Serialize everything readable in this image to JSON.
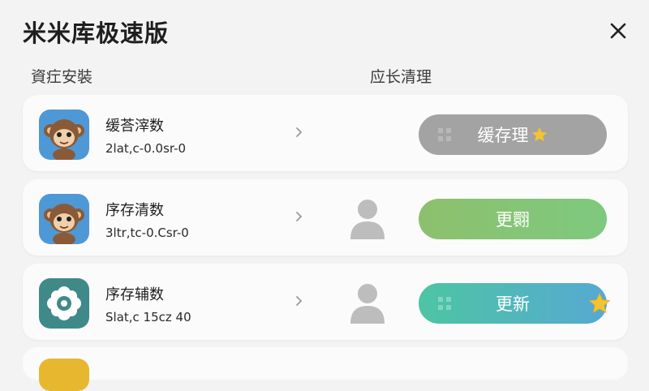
{
  "header": {
    "title": "米米库极速版"
  },
  "sections": {
    "left_label": "資疘安裝",
    "right_label": "应长清理"
  },
  "items": [
    {
      "name": "缓荅滓数",
      "meta": "2lat,c-0.0sr-0",
      "button_label": "缓存理",
      "button_style": "gray",
      "icon": "monkey-icon"
    },
    {
      "name": "序存清数",
      "meta": "3ltr,tc-0.Csr-0",
      "button_label": "更翾",
      "button_style": "green",
      "icon": "monkey-icon"
    },
    {
      "name": "序存辅数",
      "meta": "Slat,c 15cz 40",
      "button_label": "更新",
      "button_style": "teal",
      "icon": "gear-flower-icon"
    }
  ],
  "colors": {
    "gray_button": "#a3a3a3",
    "green_button": "#86c477",
    "teal_button": "#52b8bb",
    "star": "#f4c430"
  }
}
